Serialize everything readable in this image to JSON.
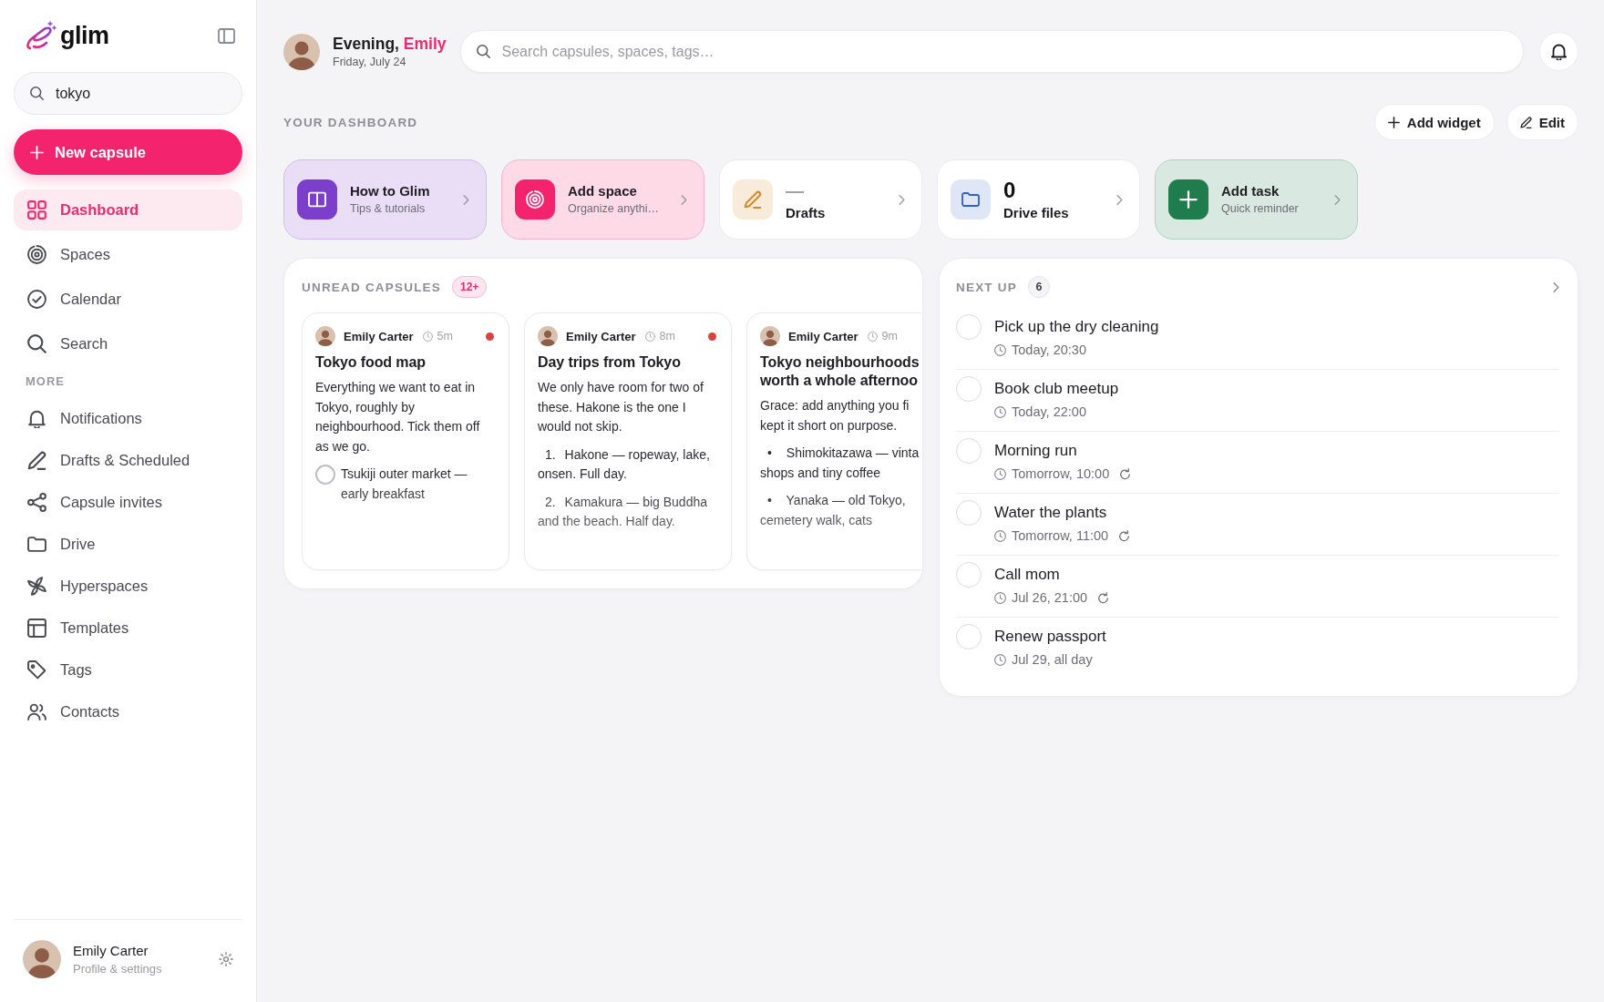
{
  "sidebar": {
    "logo": "glim",
    "search": {
      "value": "tokyo"
    },
    "new_button": "New capsule",
    "nav": [
      {
        "label": "Dashboard",
        "selected": true
      },
      {
        "label": "Spaces",
        "selected": false
      },
      {
        "label": "Calendar",
        "selected": false
      },
      {
        "label": "Search",
        "selected": false
      }
    ],
    "more_label": "MORE",
    "more": [
      {
        "label": "Notifications",
        "selected": false
      },
      {
        "label": "Drafts & Scheduled",
        "selected": false
      },
      {
        "label": "Capsule invites",
        "selected": false
      },
      {
        "label": "Drive",
        "selected": false
      },
      {
        "label": "Hyperspaces",
        "selected": false
      },
      {
        "label": "Templates",
        "selected": false
      },
      {
        "label": "Tags",
        "selected": false
      },
      {
        "label": "Contacts",
        "selected": false
      }
    ],
    "profile": {
      "name": "Emily Carter",
      "subtitle": "Profile & settings"
    }
  },
  "header": {
    "greeting": {
      "text": "Evening,",
      "name": "Emily"
    },
    "date": "Friday, July 24",
    "search": {
      "placeholder": "Search capsules, spaces, tags…"
    }
  },
  "dashboard": {
    "title": "YOUR DASHBOARD",
    "actions": [
      "Add widget",
      "Edit"
    ],
    "shortcuts": [
      {
        "kind": "action",
        "title": "How to Glim",
        "subtitle": "Tips & tutorials",
        "color": "#7b3fcb"
      },
      {
        "kind": "action",
        "title": "Add space",
        "subtitle": "Organize anythi…",
        "color": "#f3246d"
      },
      {
        "kind": "stat",
        "value": "—",
        "label": "Drafts",
        "muted": true,
        "color": "#f8ebd9"
      },
      {
        "kind": "stat",
        "value": "0",
        "label": "Drive files",
        "muted": false,
        "color": "#dfe6f6"
      },
      {
        "kind": "action",
        "title": "Add task",
        "subtitle": "Quick reminder",
        "color": "#1f7d4d"
      }
    ]
  },
  "unread_capsules": {
    "title": "UNREAD CAPSULES",
    "badge": "12+",
    "capsules": [
      {
        "author": "Emily Carter",
        "time": "5m",
        "unread": true,
        "title": "Tokyo food map",
        "body": [
          "Everything we want to eat in Tokyo, roughly by neighbourhood. Tick them off as we go."
        ],
        "items": [
          {
            "kind": "check",
            "checked": false,
            "lines": [
              "Tsukiji outer market — early breakfast"
            ]
          }
        ]
      },
      {
        "author": "Emily Carter",
        "time": "8m",
        "unread": true,
        "title": "Day trips from Tokyo",
        "body": [
          "We only have room for two of these. Hakone is the one I would not skip."
        ],
        "items": [
          {
            "kind": "number",
            "marker": "1.",
            "lines": [
              "Hakone — ropeway, lake, onsen. Full day."
            ]
          },
          {
            "kind": "number",
            "marker": "2.",
            "lines": [
              "Kamakura — big Buddha and the beach. Half day."
            ]
          }
        ]
      },
      {
        "author": "Emily Carter",
        "time": "9m",
        "unread": false,
        "title": "Tokyo neighbourhoods worth a whole afternoo",
        "body": [
          "Grace: add anything you fi",
          "kept it short on purpose."
        ],
        "items": [
          {
            "kind": "bullet",
            "marker": "•",
            "lines": [
              "Shimokitazawa — vinta",
              "shops and tiny coffee"
            ]
          },
          {
            "kind": "bullet",
            "marker": "•",
            "lines": [
              "Yanaka — old Tokyo, cemetery walk, cats"
            ]
          }
        ]
      }
    ]
  },
  "next_up": {
    "title": "NEXT UP",
    "badge": "6",
    "tasks": [
      {
        "title": "Pick up the dry cleaning",
        "time": "Today, 20:30",
        "repeat": false,
        "checked": false
      },
      {
        "title": "Book club meetup",
        "time": "Today, 22:00",
        "repeat": false,
        "checked": false
      },
      {
        "title": "Morning run",
        "time": "Tomorrow, 10:00",
        "repeat": true,
        "checked": false
      },
      {
        "title": "Water the plants",
        "time": "Tomorrow, 11:00",
        "repeat": true,
        "checked": false
      },
      {
        "title": "Call mom",
        "time": "Jul 26, 21:00",
        "repeat": true,
        "checked": false
      },
      {
        "title": "Renew passport",
        "time": "Jul 29, all day",
        "repeat": false,
        "checked": false
      }
    ]
  }
}
